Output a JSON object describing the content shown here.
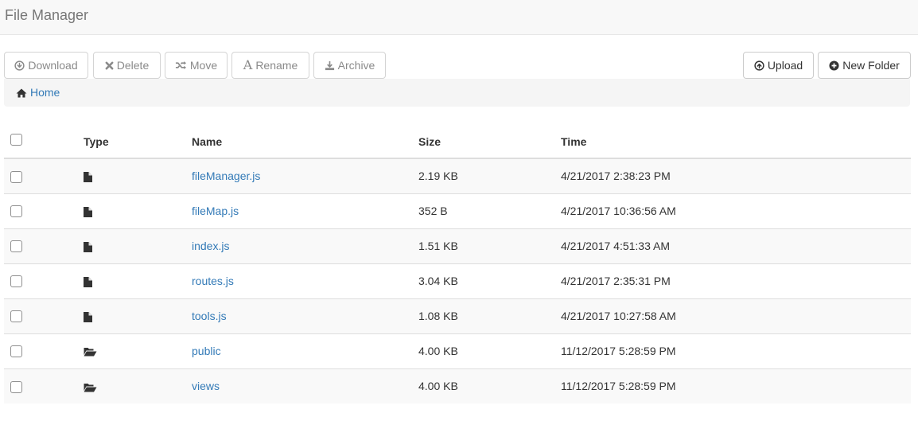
{
  "app": {
    "title": "File Manager"
  },
  "toolbar": {
    "download_label": "Download",
    "delete_label": "Delete",
    "move_label": "Move",
    "rename_label": "Rename",
    "archive_label": "Archive",
    "upload_label": "Upload",
    "new_folder_label": "New Folder"
  },
  "breadcrumb": {
    "home_label": "Home"
  },
  "table": {
    "columns": [
      "Type",
      "Name",
      "Size",
      "Time"
    ],
    "rows": [
      {
        "type": "file",
        "type_icon": "file-icon",
        "name": "fileManager.js",
        "size": "2.19 KB",
        "time": "4/21/2017 2:38:23 PM"
      },
      {
        "type": "file",
        "type_icon": "file-icon",
        "name": "fileMap.js",
        "size": "352 B",
        "time": "4/21/2017 10:36:56 AM"
      },
      {
        "type": "file",
        "type_icon": "file-icon",
        "name": "index.js",
        "size": "1.51 KB",
        "time": "4/21/2017 4:51:33 AM"
      },
      {
        "type": "file",
        "type_icon": "file-icon",
        "name": "routes.js",
        "size": "3.04 KB",
        "time": "4/21/2017 2:35:31 PM"
      },
      {
        "type": "file",
        "type_icon": "file-icon",
        "name": "tools.js",
        "size": "1.08 KB",
        "time": "4/21/2017 10:27:58 AM"
      },
      {
        "type": "folder",
        "type_icon": "folder-open-icon",
        "name": "public",
        "size": "4.00 KB",
        "time": "11/12/2017 5:28:59 PM"
      },
      {
        "type": "folder",
        "type_icon": "folder-open-icon",
        "name": "views",
        "size": "4.00 KB",
        "time": "11/12/2017 5:28:59 PM"
      }
    ]
  },
  "colors": {
    "link": "#337ab7",
    "navbar_bg": "#f8f8f8",
    "breadcrumb_bg": "#f5f5f5",
    "stripe_bg": "#f9f9f9",
    "disabled_text": "#8a8a8a"
  }
}
